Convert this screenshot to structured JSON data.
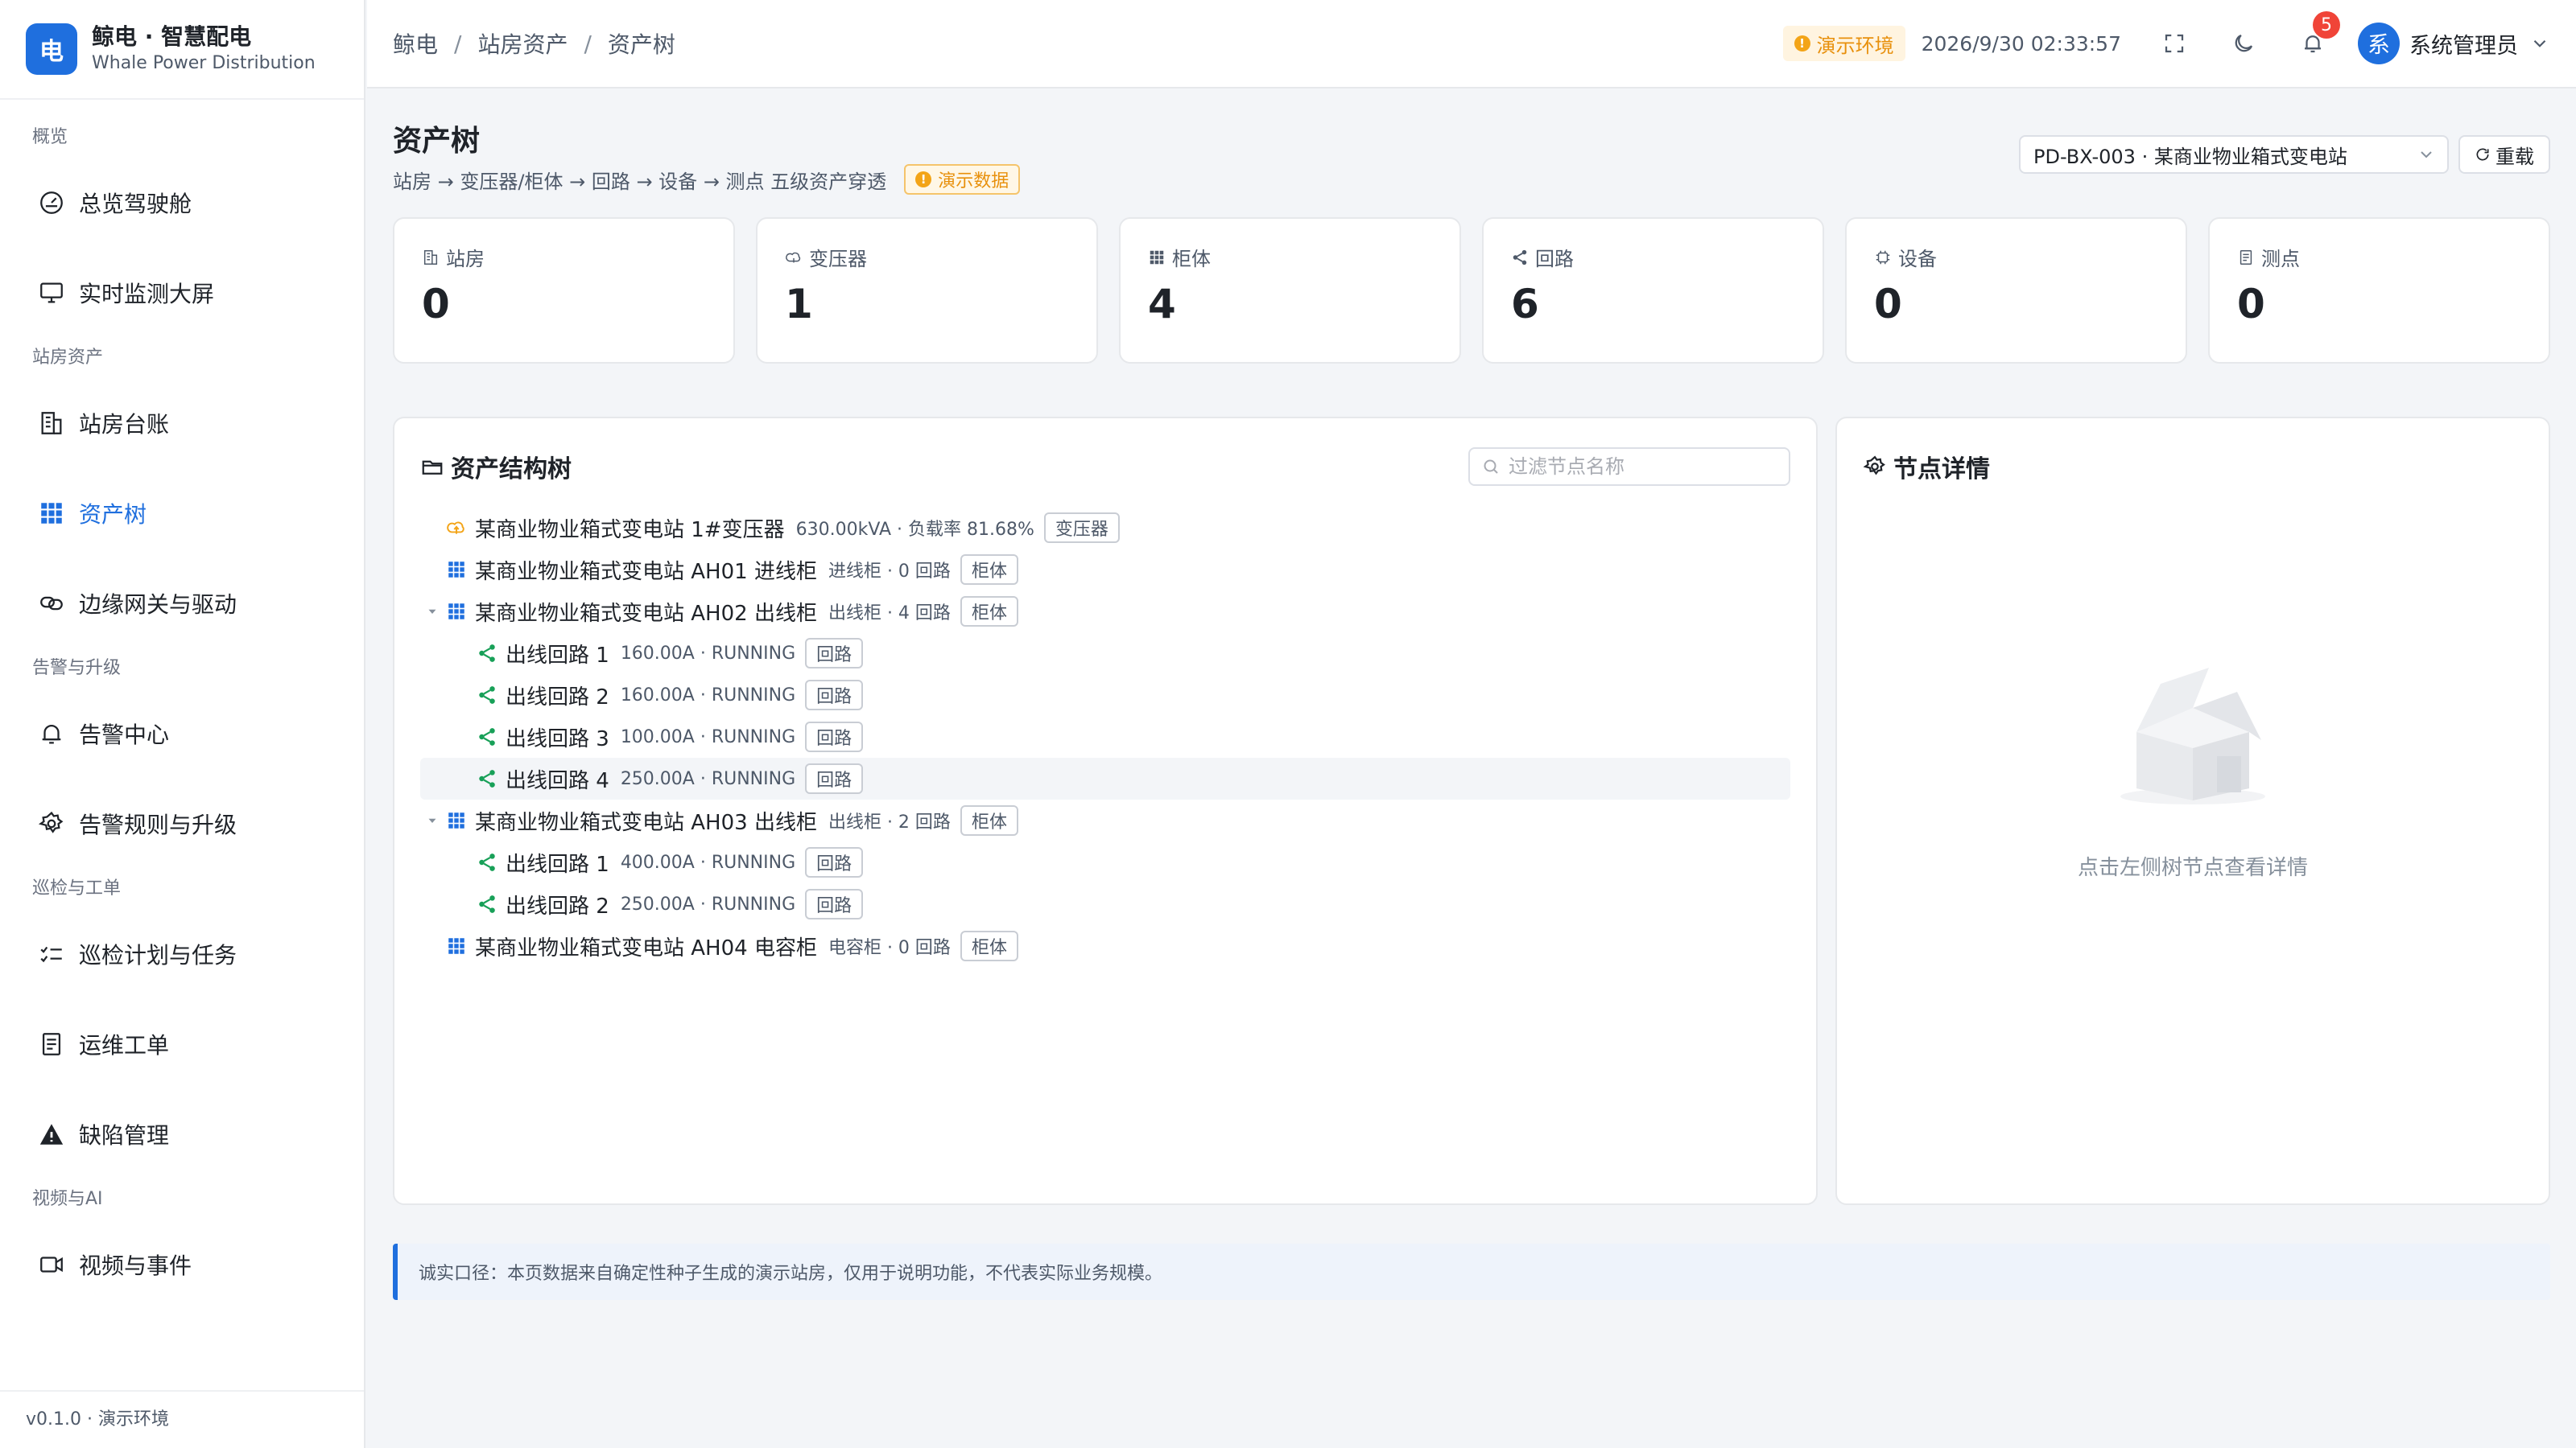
{
  "brand": {
    "logo": "电",
    "title": "鲸电 · 智慧配电",
    "subtitle": "Whale Power Distribution"
  },
  "nav": {
    "group_overview": "概览",
    "cockpit": "总览驾驶舱",
    "monitor": "实时监测大屏",
    "group_assets": "站房资产",
    "station_ledger": "站房台账",
    "asset_tree": "资产树",
    "edge_gateway": "边缘网关与驱动",
    "group_alarm": "告警与升级",
    "alarm_center": "告警中心",
    "alarm_rules": "告警规则与升级",
    "group_patrol": "巡检与工单",
    "patrol_plan": "巡检计划与任务",
    "work_order": "运维工单",
    "defect": "缺陷管理",
    "group_video": "视频与AI",
    "video_events": "视频与事件"
  },
  "footer": {
    "version": "v0.1.0 · 演示环境"
  },
  "header": {
    "breadcrumb": [
      "鲸电",
      "站房资产",
      "资产树"
    ],
    "breadcrumb_sep": "/",
    "env_label": "演示环境",
    "env_icon": "!",
    "clock": "2026/9/30 02:33:57",
    "notifications": "5",
    "avatar": "系",
    "user": "系统管理员"
  },
  "page": {
    "title": "资产树",
    "subtitle": "站房 → 变压器/柜体 → 回路 → 设备 → 测点 五级资产穿透",
    "demo_tag": "演示数据",
    "station": "PD-BX-003 · 某商业物业箱式变电站",
    "reload": "重载"
  },
  "stats": [
    {
      "label": "站房",
      "value": "0",
      "icon": "building-icon"
    },
    {
      "label": "变压器",
      "value": "1",
      "icon": "transformer-icon"
    },
    {
      "label": "柜体",
      "value": "4",
      "icon": "cabinet-icon"
    },
    {
      "label": "回路",
      "value": "6",
      "icon": "circuit-icon"
    },
    {
      "label": "设备",
      "value": "0",
      "icon": "device-icon"
    },
    {
      "label": "测点",
      "value": "0",
      "icon": "point-icon"
    }
  ],
  "tree_panel": {
    "title": "资产结构树",
    "filter_placeholder": "过滤节点名称",
    "rows": [
      {
        "name": "某商业物业箱式变电站 1#变压器",
        "meta": "630.00kVA · 负载率 81.68%",
        "tag": "变压器",
        "type": "transformer",
        "level": 0,
        "caret": false
      },
      {
        "name": "某商业物业箱式变电站 AH01 进线柜",
        "meta": "进线柜 · 0 回路",
        "tag": "柜体",
        "type": "cabinet",
        "level": 0,
        "caret": false
      },
      {
        "name": "某商业物业箱式变电站 AH02 出线柜",
        "meta": "出线柜 · 4 回路",
        "tag": "柜体",
        "type": "cabinet",
        "level": 0,
        "caret": true
      },
      {
        "name": "出线回路 1",
        "meta": "160.00A · RUNNING",
        "tag": "回路",
        "type": "circuit",
        "level": 1,
        "caret": false
      },
      {
        "name": "出线回路 2",
        "meta": "160.00A · RUNNING",
        "tag": "回路",
        "type": "circuit",
        "level": 1,
        "caret": false
      },
      {
        "name": "出线回路 3",
        "meta": "100.00A · RUNNING",
        "tag": "回路",
        "type": "circuit",
        "level": 1,
        "caret": false
      },
      {
        "name": "出线回路 4",
        "meta": "250.00A · RUNNING",
        "tag": "回路",
        "type": "circuit",
        "level": 1,
        "caret": false,
        "highlight": true
      },
      {
        "name": "某商业物业箱式变电站 AH03 出线柜",
        "meta": "出线柜 · 2 回路",
        "tag": "柜体",
        "type": "cabinet",
        "level": 0,
        "caret": true
      },
      {
        "name": "出线回路 1",
        "meta": "400.00A · RUNNING",
        "tag": "回路",
        "type": "circuit",
        "level": 1,
        "caret": false
      },
      {
        "name": "出线回路 2",
        "meta": "250.00A · RUNNING",
        "tag": "回路",
        "type": "circuit",
        "level": 1,
        "caret": false
      },
      {
        "name": "某商业物业箱式变电站 AH04 电容柜",
        "meta": "电容柜 · 0 回路",
        "tag": "柜体",
        "type": "cabinet",
        "level": 0,
        "caret": false
      }
    ]
  },
  "detail_panel": {
    "title": "节点详情",
    "empty_text": "点击左侧树节点查看详情"
  },
  "notice": "诚实口径：本页数据来自确定性种子生成的演示站房，仅用于说明功能，不代表实际业务规模。",
  "colors": {
    "primary": "#1f6fde",
    "warning": "#e8900c",
    "circuit": "#18a058",
    "transformer": "#f3a417",
    "badge": "#f04438"
  }
}
